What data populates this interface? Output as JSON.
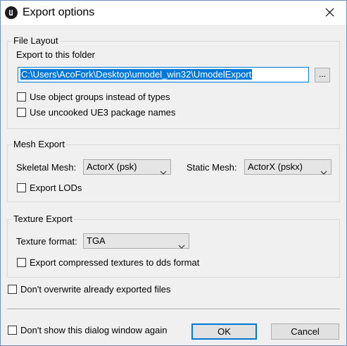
{
  "window": {
    "title": "Export options",
    "app_icon": "unreal-logo-icon",
    "close_icon": "close-icon"
  },
  "file_layout": {
    "group_label": "File Layout",
    "folder_label": "Export to this folder",
    "folder_path": "C:\\Users\\AcoFork\\Desktop\\umodel_win32\\UmodelExport",
    "browse_label": "...",
    "use_object_groups": {
      "label": "Use object groups instead of types",
      "checked": false
    },
    "use_uncooked_names": {
      "label": "Use uncooked UE3 package names",
      "checked": false
    }
  },
  "mesh_export": {
    "group_label": "Mesh Export",
    "skeletal_label": "Skeletal Mesh:",
    "skeletal_value": "ActorX (psk)",
    "static_label": "Static Mesh:",
    "static_value": "ActorX (pskx)",
    "export_lods": {
      "label": "Export LODs",
      "checked": false
    }
  },
  "texture_export": {
    "group_label": "Texture Export",
    "format_label": "Texture format:",
    "format_value": "TGA",
    "export_dds": {
      "label": "Export compressed textures to dds format",
      "checked": false
    }
  },
  "dont_overwrite": {
    "label": "Don't overwrite already exported files",
    "checked": false
  },
  "dont_show_again": {
    "label": "Don't show this dialog window again",
    "checked": false
  },
  "buttons": {
    "ok": "OK",
    "cancel": "Cancel"
  }
}
